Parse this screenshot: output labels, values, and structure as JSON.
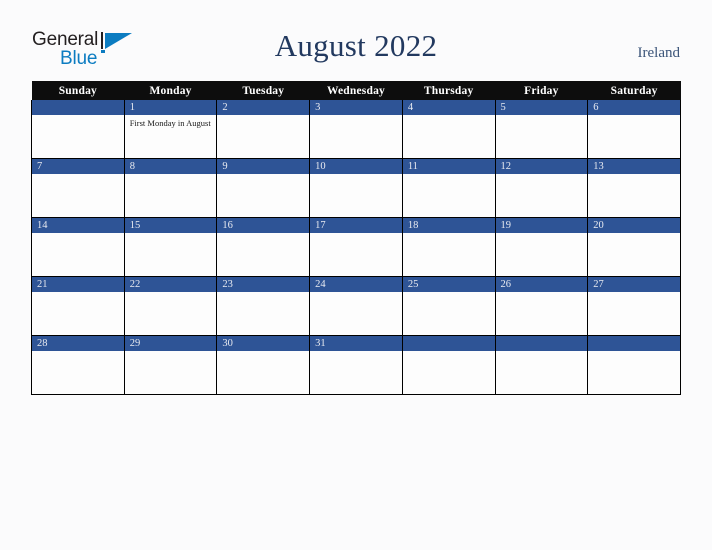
{
  "brand": {
    "name_part1": "General",
    "name_part2": "Blue",
    "mark": "triangle-logo",
    "color_dark": "#231f20",
    "color_blue": "#0c7cc1"
  },
  "header": {
    "title": "August 2022",
    "country": "Ireland",
    "title_color": "#22395f",
    "country_color": "#3b5479"
  },
  "calendar": {
    "header_bg": "#0d0d0d",
    "daybar_bg": "#2e5496",
    "daybar_text_color": "#e8eaf0",
    "weekdays": [
      "Sunday",
      "Monday",
      "Tuesday",
      "Wednesday",
      "Thursday",
      "Friday",
      "Saturday"
    ],
    "weeks": [
      [
        {
          "date": "",
          "events": []
        },
        {
          "date": "1",
          "events": [
            "First Monday in August"
          ]
        },
        {
          "date": "2",
          "events": []
        },
        {
          "date": "3",
          "events": []
        },
        {
          "date": "4",
          "events": []
        },
        {
          "date": "5",
          "events": []
        },
        {
          "date": "6",
          "events": []
        }
      ],
      [
        {
          "date": "7",
          "events": []
        },
        {
          "date": "8",
          "events": []
        },
        {
          "date": "9",
          "events": []
        },
        {
          "date": "10",
          "events": []
        },
        {
          "date": "11",
          "events": []
        },
        {
          "date": "12",
          "events": []
        },
        {
          "date": "13",
          "events": []
        }
      ],
      [
        {
          "date": "14",
          "events": []
        },
        {
          "date": "15",
          "events": []
        },
        {
          "date": "16",
          "events": []
        },
        {
          "date": "17",
          "events": []
        },
        {
          "date": "18",
          "events": []
        },
        {
          "date": "19",
          "events": []
        },
        {
          "date": "20",
          "events": []
        }
      ],
      [
        {
          "date": "21",
          "events": []
        },
        {
          "date": "22",
          "events": []
        },
        {
          "date": "23",
          "events": []
        },
        {
          "date": "24",
          "events": []
        },
        {
          "date": "25",
          "events": []
        },
        {
          "date": "26",
          "events": []
        },
        {
          "date": "27",
          "events": []
        }
      ],
      [
        {
          "date": "28",
          "events": []
        },
        {
          "date": "29",
          "events": []
        },
        {
          "date": "30",
          "events": []
        },
        {
          "date": "31",
          "events": []
        },
        {
          "date": "",
          "events": []
        },
        {
          "date": "",
          "events": []
        },
        {
          "date": "",
          "events": []
        }
      ]
    ]
  }
}
